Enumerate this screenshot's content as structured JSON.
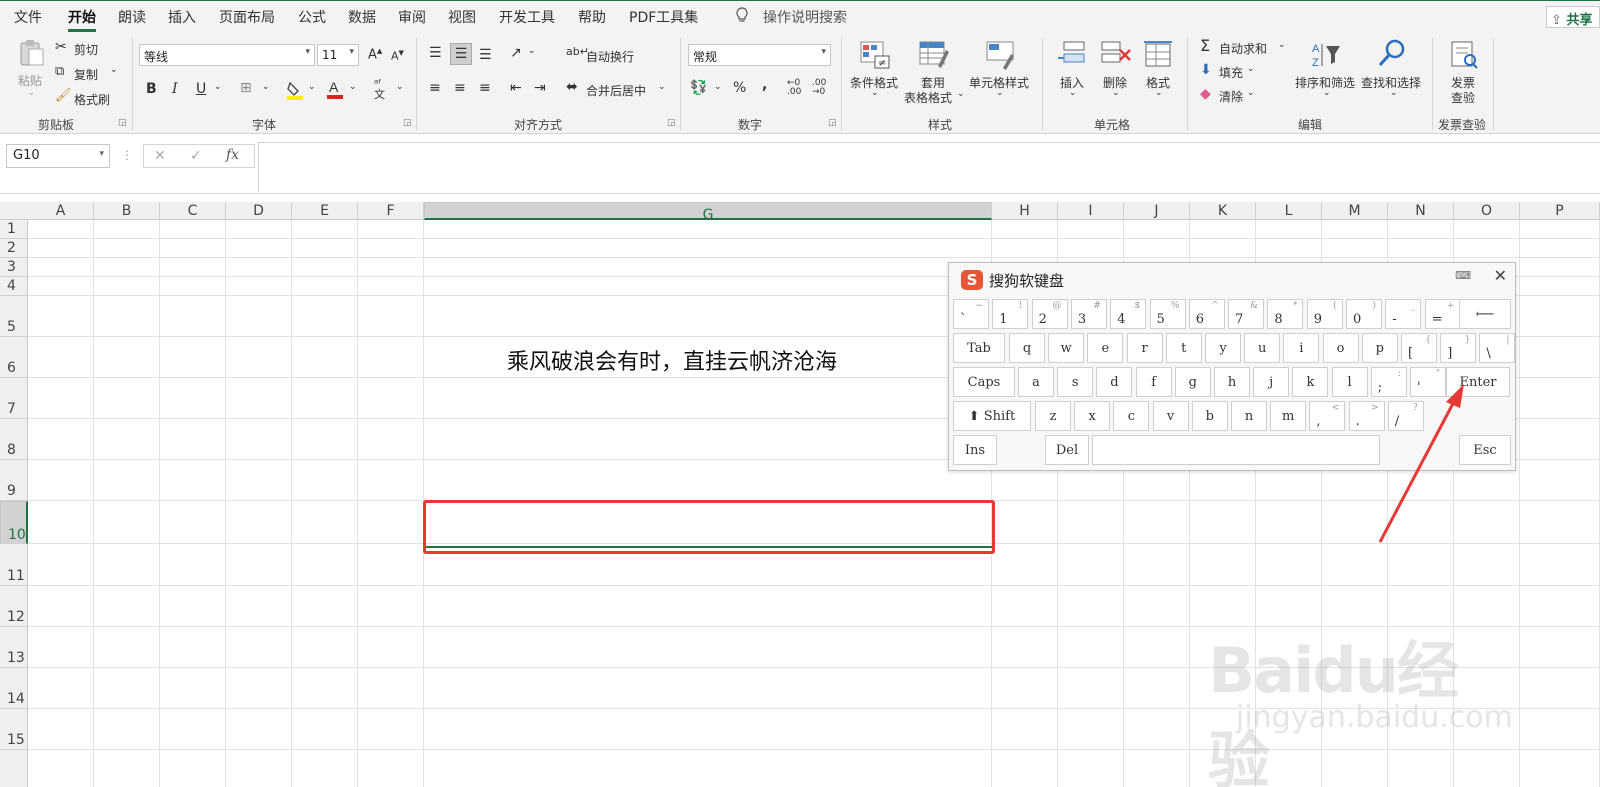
{
  "menu": {
    "items": [
      "文件",
      "开始",
      "朗读",
      "插入",
      "页面布局",
      "公式",
      "数据",
      "审阅",
      "视图",
      "开发工具",
      "帮助",
      "PDF工具集"
    ],
    "active": "开始",
    "tell_me": "操作说明搜索",
    "share": "共享"
  },
  "ribbon": {
    "clipboard": {
      "label": "剪贴板",
      "paste": "粘贴",
      "cut": "剪切",
      "copy": "复制",
      "format_painter": "格式刷"
    },
    "font": {
      "label": "字体",
      "font_name": "等线",
      "font_size": "11",
      "bold": "B",
      "italic": "I",
      "underline": "U"
    },
    "alignment": {
      "label": "对齐方式",
      "wrap": "自动换行",
      "merge": "合并后居中"
    },
    "number": {
      "label": "数字",
      "format": "常规",
      "percent": "%",
      "comma": ","
    },
    "styles": {
      "label": "样式",
      "cond_format": "条件格式",
      "table_format_1": "套用",
      "table_format_2": "表格格式",
      "cell_styles": "单元格样式"
    },
    "cells": {
      "label": "单元格",
      "insert": "插入",
      "delete": "删除",
      "format": "格式"
    },
    "editing": {
      "label": "编辑",
      "autosum": "自动求和",
      "fill": "填充",
      "clear": "清除",
      "sort": "排序和筛选",
      "find": "查找和选择"
    },
    "invoice": {
      "label": "发票查验",
      "btn_1": "发票",
      "btn_2": "查验"
    }
  },
  "formula_bar": {
    "name_box": "G10",
    "fx": "fx",
    "value": ""
  },
  "grid": {
    "columns": [
      "A",
      "B",
      "C",
      "D",
      "E",
      "F",
      "G",
      "H",
      "I",
      "J",
      "K",
      "L",
      "M",
      "N",
      "O",
      "P"
    ],
    "selected_column": "G",
    "rows": [
      "1",
      "2",
      "3",
      "4",
      "5",
      "6",
      "7",
      "8",
      "9",
      "10",
      "11",
      "12",
      "13",
      "14",
      "15"
    ],
    "selected_row": "10",
    "cell_g6": "乘风破浪会有时，直挂云帆济沧海"
  },
  "keyboard": {
    "title": "搜狗软键盘",
    "row1": [
      {
        "m": "`",
        "s": "~"
      },
      {
        "m": "1",
        "s": "!"
      },
      {
        "m": "2",
        "s": "@"
      },
      {
        "m": "3",
        "s": "#"
      },
      {
        "m": "4",
        "s": "$"
      },
      {
        "m": "5",
        "s": "%"
      },
      {
        "m": "6",
        "s": "^"
      },
      {
        "m": "7",
        "s": "&"
      },
      {
        "m": "8",
        "s": "*"
      },
      {
        "m": "9",
        "s": "("
      },
      {
        "m": "0",
        "s": ")"
      },
      {
        "m": "-",
        "s": "_"
      },
      {
        "m": "=",
        "s": "+"
      }
    ],
    "backspace": "⟵",
    "tab": "Tab",
    "row2": [
      {
        "m": "q",
        "s": ""
      },
      {
        "m": "w",
        "s": ""
      },
      {
        "m": "e",
        "s": ""
      },
      {
        "m": "r",
        "s": ""
      },
      {
        "m": "t",
        "s": ""
      },
      {
        "m": "y",
        "s": ""
      },
      {
        "m": "u",
        "s": ""
      },
      {
        "m": "i",
        "s": ""
      },
      {
        "m": "o",
        "s": ""
      },
      {
        "m": "p",
        "s": ""
      },
      {
        "m": "[",
        "s": "{"
      },
      {
        "m": "]",
        "s": "}"
      },
      {
        "m": "\\",
        "s": "|"
      }
    ],
    "caps": "Caps",
    "row3": [
      {
        "m": "a",
        "s": ""
      },
      {
        "m": "s",
        "s": ""
      },
      {
        "m": "d",
        "s": ""
      },
      {
        "m": "f",
        "s": ""
      },
      {
        "m": "g",
        "s": ""
      },
      {
        "m": "h",
        "s": ""
      },
      {
        "m": "j",
        "s": ""
      },
      {
        "m": "k",
        "s": ""
      },
      {
        "m": "l",
        "s": ""
      },
      {
        "m": ";",
        "s": ":"
      },
      {
        "m": "'",
        "s": "\""
      }
    ],
    "enter": "Enter",
    "shift": "⬆ Shift",
    "row4": [
      {
        "m": "z",
        "s": ""
      },
      {
        "m": "x",
        "s": ""
      },
      {
        "m": "c",
        "s": ""
      },
      {
        "m": "v",
        "s": ""
      },
      {
        "m": "b",
        "s": ""
      },
      {
        "m": "n",
        "s": ""
      },
      {
        "m": "m",
        "s": ""
      },
      {
        "m": ",",
        "s": "<"
      },
      {
        "m": ".",
        "s": ">"
      },
      {
        "m": "/",
        "s": "?"
      }
    ],
    "ins": "Ins",
    "del": "Del",
    "esc": "Esc"
  },
  "watermark": {
    "logo": "Baidu经验",
    "url": "jingyan.baidu.com"
  },
  "colors": {
    "excel_green": "#217346",
    "highlight_red": "#e53935",
    "sogou_orange": "#e8563a"
  }
}
